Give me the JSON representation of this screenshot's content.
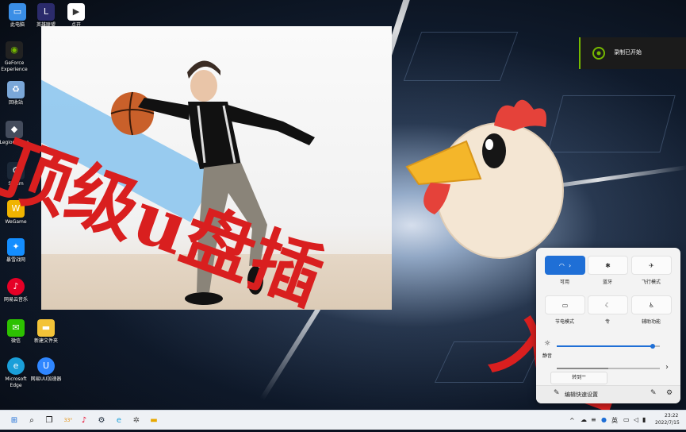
{
  "desktop": {
    "icons": [
      {
        "label": "此电脑",
        "icon": "computer-icon",
        "color": "#3a8ee6"
      },
      {
        "label": "英雄联盟",
        "icon": "lol-icon",
        "color": "#2b2b6b"
      },
      {
        "label": "点开",
        "icon": "video-file-icon",
        "color": "#ffffff"
      },
      {
        "label": "GeForce Experience",
        "icon": "nvidia-icon",
        "color": "#76b900"
      },
      {
        "label": "回收站",
        "icon": "recycle-bin-icon",
        "color": "#7aa7d8"
      },
      {
        "label": "Legion Zone",
        "icon": "legion-icon",
        "color": "#444c5c"
      },
      {
        "label": "Steam",
        "icon": "steam-icon",
        "color": "#1b2838"
      },
      {
        "label": "WeGame",
        "icon": "wegame-icon",
        "color": "#f0b400"
      },
      {
        "label": "暴雪战网",
        "icon": "battlenet-icon",
        "color": "#148eff"
      },
      {
        "label": "网易云音乐",
        "icon": "netease-music-icon",
        "color": "#e60026"
      },
      {
        "label": "微信",
        "icon": "wechat-icon",
        "color": "#2dc100"
      },
      {
        "label": "新建文件夹",
        "icon": "folder-icon",
        "color": "#f3c338"
      },
      {
        "label": "Microsoft Edge",
        "icon": "edge-icon",
        "color": "#1a9fd9"
      },
      {
        "label": "网易UU加速器",
        "icon": "uu-accelerator-icon",
        "color": "#2f86ff"
      }
    ]
  },
  "overlay": {
    "title_line1": "顶级u盘插",
    "title_line2": "入音"
  },
  "notification": {
    "text": "录制已开始",
    "icon": "record-icon",
    "accent": "#76b900"
  },
  "quick_settings": {
    "tiles": [
      {
        "label": "可用",
        "icon": "wifi-icon",
        "on": true
      },
      {
        "label": "蓝牙",
        "icon": "bluetooth-icon",
        "on": false
      },
      {
        "label": "飞行模式",
        "icon": "airplane-icon",
        "on": false
      },
      {
        "label": "节电模式",
        "icon": "battery-saver-icon",
        "on": false
      },
      {
        "label": "专",
        "icon": "focus-icon",
        "on": false
      },
      {
        "label": "辅助功能",
        "icon": "accessibility-icon",
        "on": false
      }
    ],
    "brightness_icon": "brightness-icon",
    "brightness": 0.93,
    "volume_label": "静音",
    "volume": 0.5,
    "cast_label": "转到\"\"",
    "edit_label": "编辑快速设置",
    "accent": "#1f6fd6"
  },
  "taskbar": {
    "weather_temp": "33°",
    "lang": "英",
    "time": "23:22",
    "date": "2022/7/15"
  }
}
